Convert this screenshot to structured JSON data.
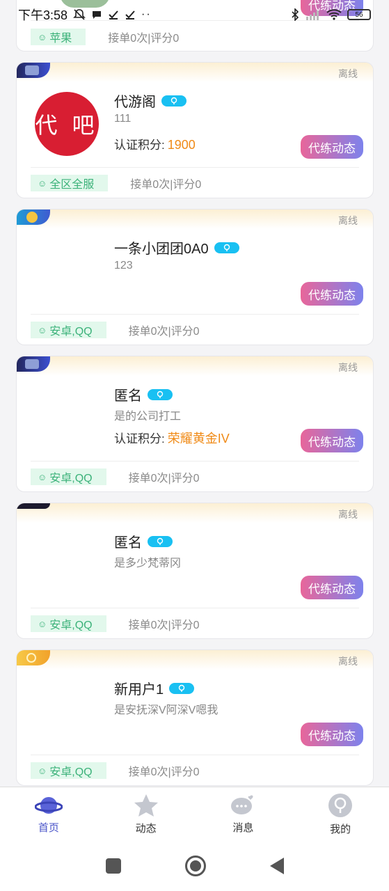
{
  "status_bar": {
    "time": "下午3:58",
    "battery": "56",
    "icons": [
      "mute-icon",
      "message-icon",
      "check-icon",
      "check-icon",
      "more-icon",
      "bluetooth-icon",
      "signal-icon",
      "wifi-icon"
    ]
  },
  "top_partial": {
    "button_label": "代练动态",
    "tag": "苹果",
    "stats": "接单0次|评分0"
  },
  "cards": [
    {
      "status": "离线",
      "avatar_text": "代 吧",
      "name": "代游阁",
      "desc": "111",
      "score_label": "认证积分:",
      "score_value": "1900",
      "button_label": "代练动态",
      "tag": "全区全服",
      "stats": "接单0次|评分0"
    },
    {
      "status": "离线",
      "name": "一条小团团0A0",
      "desc": "123",
      "button_label": "代练动态",
      "tag": "安卓,QQ",
      "stats": "接单0次|评分0"
    },
    {
      "status": "离线",
      "name": "匿名",
      "desc": "是的公司打工",
      "score_label": "认证积分:",
      "score_value": "荣耀黄金IV",
      "button_label": "代练动态",
      "tag": "安卓,QQ",
      "stats": "接单0次|评分0"
    },
    {
      "status": "离线",
      "name": "匿名",
      "desc": "是多少梵蒂冈",
      "button_label": "代练动态",
      "tag": "安卓,QQ",
      "stats": "接单0次|评分0"
    },
    {
      "status": "离线",
      "name": "新用户1",
      "desc": "是安抚深V阿深V嗯我",
      "button_label": "代练动态",
      "tag": "安卓,QQ",
      "stats": "接单0次|评分0"
    }
  ],
  "nav": [
    {
      "label": "首页",
      "icon": "planet-icon",
      "active": true
    },
    {
      "label": "动态",
      "icon": "star-icon",
      "active": false
    },
    {
      "label": "消息",
      "icon": "chat-bubble-icon",
      "active": false
    },
    {
      "label": "我的",
      "icon": "profile-icon",
      "active": false
    }
  ],
  "colors": {
    "accent": "#4b55c9",
    "button_gradient_start": "#e8669a",
    "button_gradient_end": "#7d82ec",
    "score": "#f08a16",
    "tag_bg": "#e2f8ec",
    "tag_text": "#3cb27a"
  }
}
